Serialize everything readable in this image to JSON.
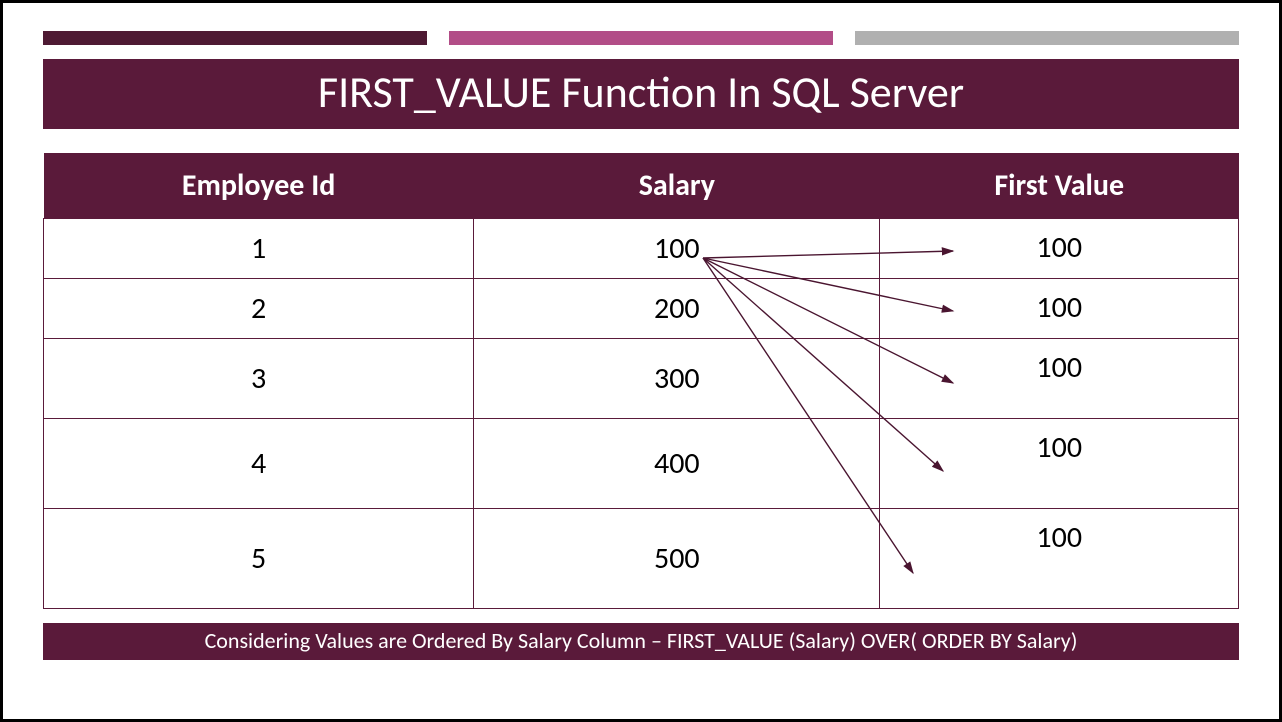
{
  "colors": {
    "brand": "#5a1a3a",
    "accent1": "#4e1a33",
    "accent2": "#b24d87",
    "accent3": "#b0b0b0"
  },
  "title": "FIRST_VALUE Function In SQL Server",
  "table": {
    "headers": {
      "col1": "Employee Id",
      "col2": "Salary",
      "col3": "First Value"
    },
    "rows": [
      {
        "employee_id": "1",
        "salary": "100",
        "first_value": "100"
      },
      {
        "employee_id": "2",
        "salary": "200",
        "first_value": "100"
      },
      {
        "employee_id": "3",
        "salary": "300",
        "first_value": "100"
      },
      {
        "employee_id": "4",
        "salary": "400",
        "first_value": "100"
      },
      {
        "employee_id": "5",
        "salary": "500",
        "first_value": "100"
      }
    ]
  },
  "footer": "Considering Values are Ordered By Salary Column – FIRST_VALUE (Salary) OVER( ORDER BY Salary)"
}
